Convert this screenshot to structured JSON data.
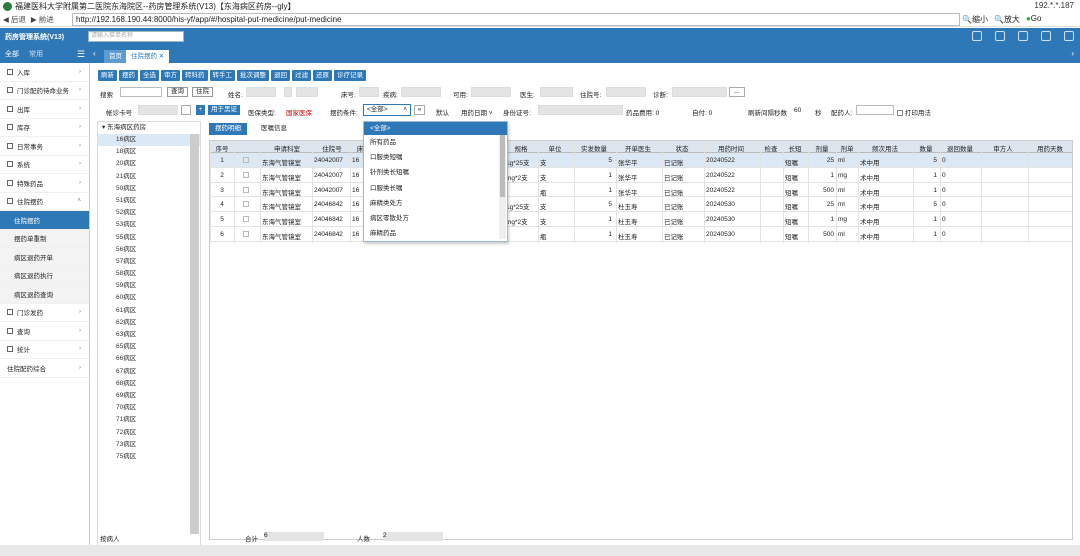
{
  "browser": {
    "title": "福建医科大学附属第二医院东海院区--药房管理系统(V13)【东海病区药房--gly】",
    "ip_corner": "192.*.*.187",
    "back": "后退",
    "forward": "前进",
    "url": "http://192.168.190.44:8000/his-yf/app/#/hospital-put-medicine/put-medicine",
    "zoom_out": "缩小",
    "zoom_in": "放大",
    "go": "Go"
  },
  "app": {
    "name": "药房管理系统(V13)",
    "search_placeholder": "请输入菜单名称"
  },
  "left_tabs": {
    "all": "全部",
    "fav": "常用"
  },
  "sidebar": [
    {
      "label": "入库",
      "type": "group"
    },
    {
      "label": "门诊配药待命业务",
      "type": "group"
    },
    {
      "label": "出库",
      "type": "group"
    },
    {
      "label": "库存",
      "type": "group"
    },
    {
      "label": "日常事务",
      "type": "group"
    },
    {
      "label": "系统",
      "type": "group"
    },
    {
      "label": "特殊药品",
      "type": "group"
    },
    {
      "label": "住院摆药",
      "type": "group"
    },
    {
      "label": "住院摆药",
      "type": "sub-selected"
    },
    {
      "label": "摆药单重制",
      "type": "sub"
    },
    {
      "label": "病区退药开单",
      "type": "sub"
    },
    {
      "label": "病区退药执行",
      "type": "sub"
    },
    {
      "label": "病区退药查询",
      "type": "sub"
    },
    {
      "label": "门诊发药",
      "type": "group"
    },
    {
      "label": "查询",
      "type": "group"
    },
    {
      "label": "统计",
      "type": "group"
    },
    {
      "label": "住院配药综合",
      "type": "group"
    }
  ],
  "page_tabs": {
    "home": "首页",
    "current": "住院摆药"
  },
  "toolbar": [
    "刷新",
    "摆药",
    "全选",
    "审方",
    "转科药",
    "转手工",
    "批次调整",
    "退回",
    "过滤",
    "还原",
    "诊疗记录"
  ],
  "filters_row1": {
    "search": "搜索",
    "query": "查询",
    "hospitalized": "住院",
    "name": "姓名:",
    "bed": "床号:",
    "disease": "疾病:",
    "usable": "可用:",
    "doctor": "医生:",
    "admission_no": "住院号:",
    "diagnosis": "诊断:",
    "more": "..."
  },
  "filters_row2": {
    "card_no": "帐诊卡号",
    "mark": "用于黑证",
    "insurance_type": "医保类型:",
    "insurance_value": "国家医保",
    "condition": "摆药条件:",
    "condition_value": "<全部>",
    "default": "默认",
    "date_type": "用药日期",
    "id_no": "身份证号:",
    "drug_fee": "药品费用: 0",
    "self_pay": "自付: 0",
    "refresh_interval": "刷新间隔秒数",
    "refresh_value": "60",
    "seconds": "秒",
    "dispenser": "配药人:",
    "print": "打印用法"
  },
  "tree": {
    "root": "东海病区药房",
    "wards": [
      "16病区",
      "18病区",
      "20病区",
      "21病区",
      "50病区",
      "51病区",
      "52病区",
      "53病区",
      "55病区",
      "56病区",
      "57病区",
      "58病区",
      "59病区",
      "60病区",
      "61病区",
      "62病区",
      "63病区",
      "65病区",
      "66病区",
      "67病区",
      "68病区",
      "69病区",
      "70病区",
      "71病区",
      "72病区",
      "73病区",
      "75病区"
    ]
  },
  "sub_tabs": [
    "摆药明细",
    "医嘱信息"
  ],
  "grid": {
    "headers": [
      "序号",
      "",
      "申请科室",
      "住院号",
      "床",
      "",
      "规格",
      "单位",
      "实发数量",
      "开单医生",
      "状态",
      "用药时间",
      "检查",
      "长短",
      "剂量",
      "剂单",
      "频次用法",
      "数量",
      "退回数量",
      "审方人",
      "用药天数"
    ],
    "rows": [
      [
        "1",
        "",
        "东海气管镜室",
        "24042007",
        "16",
        "",
        "1g*25支",
        "支",
        "5",
        "张华平",
        "已记账",
        "20240522",
        "",
        "短嘱",
        "25",
        "ml",
        "术中用",
        "5",
        "0",
        "",
        ""
      ],
      [
        "2",
        "",
        "东海气管镜室",
        "24042007",
        "16",
        "",
        "mg*2支",
        "支",
        "1",
        "张华平",
        "已记账",
        "20240522",
        "",
        "短嘱",
        "1",
        "mg",
        "术中用",
        "1",
        "0",
        "",
        ""
      ],
      [
        "3",
        "",
        "东海气管镜室",
        "24042007",
        "16",
        "",
        "l",
        "瓶",
        "1",
        "张华平",
        "已记账",
        "20240522",
        "",
        "短嘱",
        "500",
        "ml",
        "术中用",
        "1",
        "0",
        "",
        ""
      ],
      [
        "4",
        "",
        "东海气管镜室",
        "24046842",
        "16",
        "",
        "1g*25支",
        "支",
        "5",
        "杜玉寿",
        "已记账",
        "20240530",
        "",
        "短嘱",
        "25",
        "ml",
        "术中用",
        "5",
        "0",
        "",
        ""
      ],
      [
        "5",
        "",
        "东海气管镜室",
        "24046842",
        "16",
        "",
        "mg*2支",
        "支",
        "1",
        "杜玉寿",
        "已记账",
        "20240530",
        "",
        "短嘱",
        "1",
        "mg",
        "术中用",
        "1",
        "0",
        "",
        ""
      ],
      [
        "6",
        "",
        "东海气管镜室",
        "24046842",
        "16",
        "",
        "l",
        "瓶",
        "1",
        "杜玉寿",
        "已记账",
        "20240530",
        "",
        "短嘱",
        "500",
        "ml",
        "术中用",
        "1",
        "0",
        "",
        ""
      ]
    ]
  },
  "dropdown": {
    "selected": "<全部>",
    "options": [
      "所有药品",
      "口服类短嘱",
      "针剂类长短嘱",
      "口服类长嘱",
      "麻精类处方",
      "病区零散处方",
      "麻精药品"
    ]
  },
  "footer": {
    "patient": "按病人",
    "total_label": "合计",
    "total_value": "6",
    "count_label": "人数",
    "count_value": "2"
  }
}
